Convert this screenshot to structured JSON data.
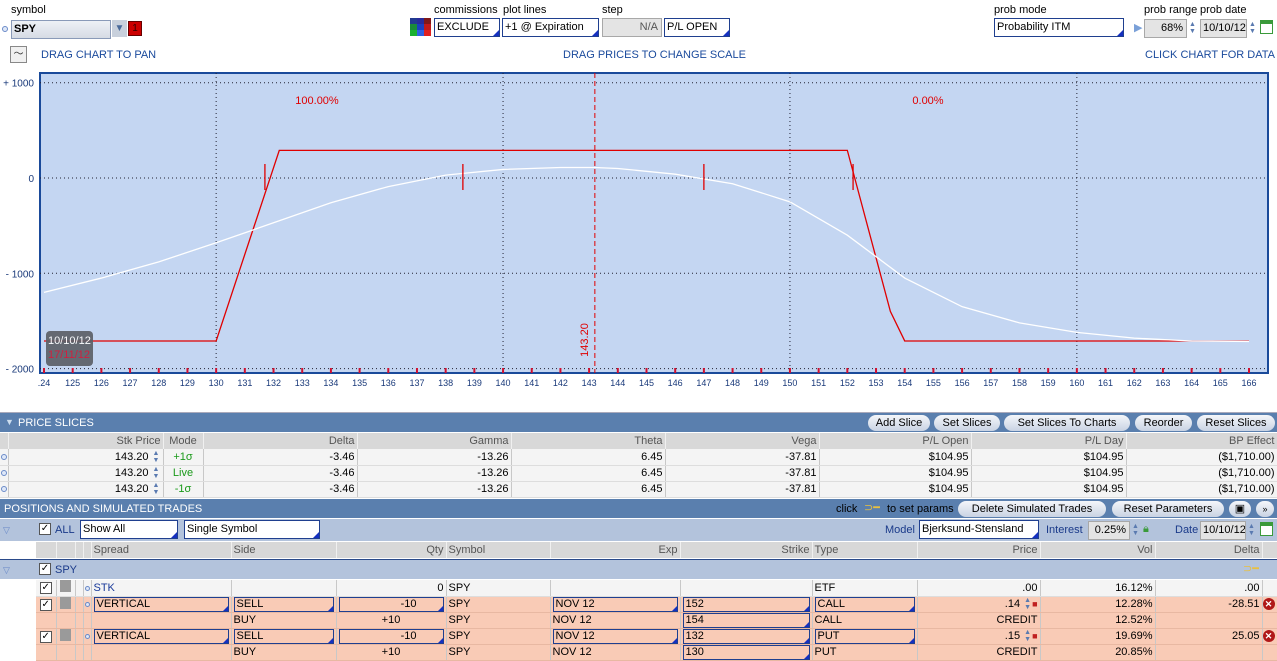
{
  "top": {
    "symbol_label": "symbol",
    "symbol_value": "SPY",
    "symbol_badge": "1",
    "commissions_label": "commissions",
    "commissions_value": "EXCLUDE",
    "plot_lines_label": "plot lines",
    "plot_lines_value": "+1 @ Expiration",
    "step_label": "step",
    "step_value": "N/A",
    "pl_mode": "P/L OPEN",
    "prob_mode_label": "prob mode",
    "prob_mode_value": "Probability ITM",
    "prob_range_label": "prob range",
    "prob_range_value": "68%",
    "prob_date_label": "prob date",
    "prob_date_value": "10/10/12",
    "drag_pan": "DRAG CHART TO PAN",
    "drag_prices": "DRAG PRICES TO CHANGE SCALE",
    "click_chart": "CLICK CHART FOR DATA"
  },
  "chart_data": {
    "type": "line",
    "xlim": [
      123.9,
      166.6
    ],
    "ylim": [
      -2050,
      1050
    ],
    "x_ticks": [
      ".24",
      "125",
      "126",
      "127",
      "128",
      "129",
      "130",
      "131",
      "132",
      "133",
      "134",
      "135",
      "136",
      "137",
      "138",
      "139",
      "140",
      "141",
      "142",
      "143",
      "144",
      "145",
      "146",
      "147",
      "148",
      "149",
      "150",
      "151",
      "152",
      "153",
      "154",
      "155",
      "156",
      "157",
      "158",
      "159",
      "160",
      "161",
      "162",
      "163",
      "164",
      "165",
      "166"
    ],
    "y_ticks": [
      {
        "v": 1000,
        "t": "+ 1000"
      },
      {
        "v": 0,
        "t": "0"
      },
      {
        "v": -1000,
        "t": "- 1000"
      },
      {
        "v": -2000,
        "t": "- 2000"
      }
    ],
    "v_grid": [
      130,
      140,
      150,
      160
    ],
    "current_price": 143.2,
    "current_price_label": "143.20",
    "prob_left": "100.00%",
    "prob_right": "0.00%",
    "date_today": "10/10/12",
    "date_exp": "17/11/12",
    "series": [
      {
        "name": "Expiration",
        "color": "#e00000",
        "x": [
          124,
          130,
          132.2,
          152,
          153.5,
          154,
          166
        ],
        "y": [
          -1710,
          -1710,
          290,
          290,
          -1400,
          -1710,
          -1710
        ]
      },
      {
        "name": "Today",
        "color": "#ffffff",
        "x": [
          124,
          126,
          128,
          130,
          132,
          134,
          136,
          138,
          140,
          142,
          143.2,
          144,
          146,
          148,
          150,
          152,
          154,
          156,
          158,
          160,
          162,
          164,
          166
        ],
        "y": [
          -1200,
          -1050,
          -880,
          -680,
          -470,
          -260,
          -90,
          30,
          90,
          110,
          110,
          100,
          40,
          -60,
          -250,
          -600,
          -1050,
          -1350,
          -1520,
          -1620,
          -1680,
          -1710,
          -1715
        ]
      }
    ],
    "markers": [
      131.7,
      138.6,
      147,
      152.2
    ]
  },
  "price_slices": {
    "title": "PRICE SLICES",
    "buttons": [
      "Add Slice",
      "Set Slices",
      "Set Slices To Charts",
      "Reorder",
      "Reset Slices"
    ],
    "columns": [
      "Stk Price",
      "Mode",
      "Delta",
      "Gamma",
      "Theta",
      "Vega",
      "P/L Open",
      "P/L Day",
      "BP Effect"
    ],
    "rows": [
      [
        "143.20",
        "+1σ",
        "-3.46",
        "-13.26",
        "6.45",
        "-37.81",
        "$104.95",
        "$104.95",
        "($1,710.00)"
      ],
      [
        "143.20",
        "Live",
        "-3.46",
        "-13.26",
        "6.45",
        "-37.81",
        "$104.95",
        "$104.95",
        "($1,710.00)"
      ],
      [
        "143.20",
        "-1σ",
        "-3.46",
        "-13.26",
        "6.45",
        "-37.81",
        "$104.95",
        "$104.95",
        "($1,710.00)"
      ]
    ]
  },
  "positions": {
    "title": "POSITIONS AND SIMULATED TRADES",
    "click_text": "click",
    "set_params": "to set params",
    "delete_btn": "Delete Simulated Trades",
    "reset_btn": "Reset Parameters",
    "all_label": "ALL",
    "filter": "Show All",
    "mode": "Single Symbol",
    "model_label": "Model",
    "model_value": "Bjerksund-Stensland",
    "interest_label": "Interest",
    "interest_value": "0.25%",
    "date_label": "Date",
    "date_value": "10/10/12",
    "columns": [
      "Spread",
      "Side",
      "Qty",
      "Symbol",
      "Exp",
      "Strike",
      "Type",
      "Price",
      "Vol",
      "Delta"
    ],
    "group": "SPY",
    "stk": {
      "spread": "STK",
      "qty": "0",
      "symbol": "SPY",
      "type": "ETF",
      "price": ".00",
      "vol": "16.12%",
      "delta": ".00"
    },
    "verticals": [
      {
        "spread": "VERTICAL",
        "side1": "SELL",
        "qty1": "-10",
        "sym": "SPY",
        "exp": "NOV 12",
        "strike1": "152",
        "type1": "CALL",
        "price": ".14",
        "vol1": "12.28%",
        "delta": "-28.51",
        "side2": "BUY",
        "qty2": "+10",
        "strike2": "154",
        "type2": "CALL",
        "price2": "CREDIT",
        "vol2": "12.52%"
      },
      {
        "spread": "VERTICAL",
        "side1": "SELL",
        "qty1": "-10",
        "sym": "SPY",
        "exp": "NOV 12",
        "strike1": "132",
        "type1": "PUT",
        "price": ".15",
        "vol1": "19.69%",
        "delta": "25.05",
        "side2": "BUY",
        "qty2": "+10",
        "strike2": "130",
        "type2": "PUT",
        "price2": "CREDIT",
        "vol2": "20.85%"
      }
    ]
  }
}
